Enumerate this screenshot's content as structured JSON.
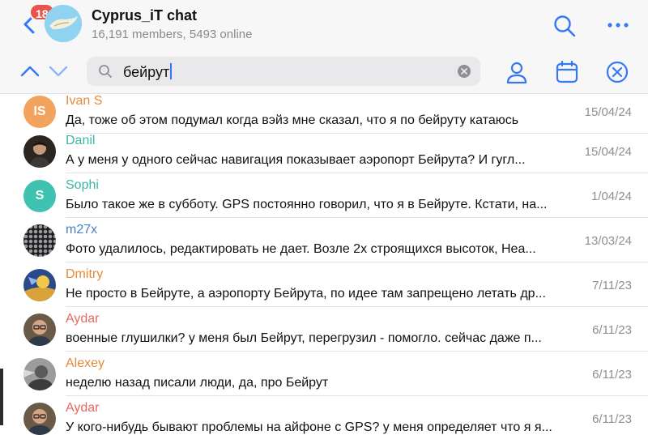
{
  "header": {
    "unread_badge": "18",
    "title": "Cyprus_iT chat",
    "subtitle": "16,191 members, 5493 online"
  },
  "search": {
    "query": "бейрут"
  },
  "results": [
    {
      "name": "Ivan S",
      "initials": "IS",
      "name_color": "#e8893a",
      "message": "Да, тоже об этом подумал когда вэйз мне сказал, что я по бейруту катаюсь",
      "date": "15/04/24"
    },
    {
      "name": "Danil",
      "initials": "",
      "name_color": "#3fb6a8",
      "message": "А у меня у одного сейчас навигация показывает  аэропорт Бейрута? И гугл...",
      "date": "15/04/24"
    },
    {
      "name": "Sophi",
      "initials": "S",
      "name_color": "#3fb6a8",
      "message": "Было такое же в субботу. GPS постоянно говорил, что я в Бейруте. Кстати, на...",
      "date": "1/04/24"
    },
    {
      "name": "m27x",
      "initials": "",
      "name_color": "#4a7fc1",
      "message": "Фото удалилось, редактировать не дает. Возле 2х строящихся высоток, Неа...",
      "date": "13/03/24"
    },
    {
      "name": "Dmitry",
      "initials": "",
      "name_color": "#e8893a",
      "message": "Не просто в Бейруте, а аэропорту Бейрута, по идее там запрещено летать др...",
      "date": "7/11/23"
    },
    {
      "name": "Aydar",
      "initials": "",
      "name_color": "#e46a5e",
      "message": "военные глушилки? у меня был Бейрут, перегрузил - помогло. сейчас даже п...",
      "date": "6/11/23"
    },
    {
      "name": "Alexey",
      "initials": "",
      "name_color": "#e8893a",
      "message": "неделю назад писали люди, да, про Бейрут",
      "date": "6/11/23"
    },
    {
      "name": "Aydar",
      "initials": "",
      "name_color": "#e46a5e",
      "message": "У кого-нибудь бывают проблемы на айфоне с GPS? у меня определяет что я я...",
      "date": "6/11/23"
    }
  ],
  "colors": {
    "accent": "#3478f6",
    "badge": "#e8534e",
    "avatar_is": "#f2a35e",
    "avatar_s": "#3fc3b0"
  },
  "icons": [
    "back-chevron-icon",
    "search-icon",
    "more-icon",
    "chevron-up-icon",
    "chevron-down-icon",
    "magnifier-icon",
    "clear-icon",
    "person-icon",
    "calendar-icon",
    "close-circle-icon"
  ]
}
